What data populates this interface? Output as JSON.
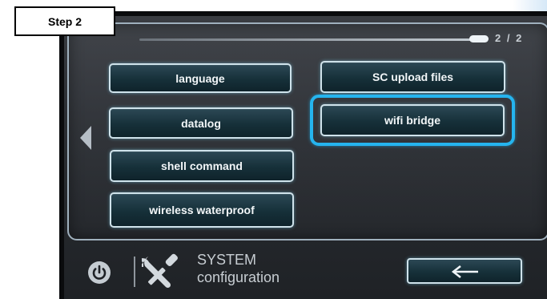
{
  "step_label": "Step 2",
  "pager": {
    "indicator": "2 / 2"
  },
  "menu": {
    "left": [
      {
        "label": "language"
      },
      {
        "label": "datalog"
      },
      {
        "label": "shell command"
      },
      {
        "label": "wireless waterproof"
      }
    ],
    "right": [
      {
        "label": "SC upload files"
      },
      {
        "label": "wifi bridge",
        "highlighted": true
      }
    ]
  },
  "footer": {
    "title": "SYSTEM",
    "subtitle": "configuration",
    "icons": [
      "power-icon",
      "tools-icon",
      "back-arrow-icon"
    ]
  },
  "colors": {
    "highlight": "#25b4ee",
    "button_border": "#cfe2ea",
    "button_fill": "#163039",
    "text": "#f2f6f8"
  }
}
